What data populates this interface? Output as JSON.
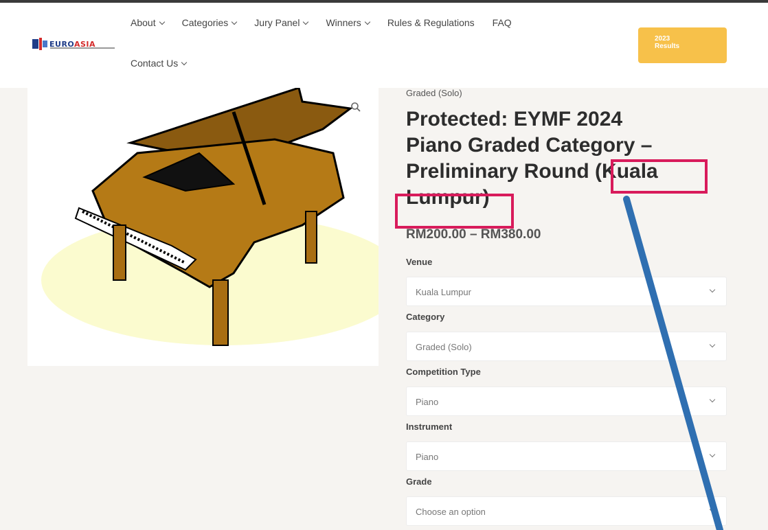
{
  "header": {
    "logo": {
      "part1": "EURO",
      "part2": "ASIA"
    },
    "nav": [
      {
        "label": "About",
        "has_dropdown": true
      },
      {
        "label": "Categories",
        "has_dropdown": true
      },
      {
        "label": "Jury Panel",
        "has_dropdown": true
      },
      {
        "label": "Winners",
        "has_dropdown": true
      },
      {
        "label": "Rules & Regulations",
        "has_dropdown": false
      },
      {
        "label": "FAQ",
        "has_dropdown": false
      },
      {
        "label": "Contact Us",
        "has_dropdown": true
      }
    ],
    "results_button": {
      "line1": "2023",
      "line2": "Results"
    }
  },
  "product": {
    "category": "Graded (Solo)",
    "title": "Protected: EYMF 2024 Piano Graded Category – Preliminary Round (Kuala Lumpur)",
    "title_lines": [
      "Protected: EYMF 2024",
      "Piano Graded Category –",
      "Preliminary Round (Kuala",
      "Lumpur)"
    ],
    "price": "RM200.00 – RM380.00",
    "fields": [
      {
        "label": "Venue",
        "value": "Kuala Lumpur"
      },
      {
        "label": "Category",
        "value": "Graded (Solo)"
      },
      {
        "label": "Competition Type",
        "value": "Piano"
      },
      {
        "label": "Instrument",
        "value": "Piano"
      },
      {
        "label": "Grade",
        "value": "Choose an option"
      }
    ]
  },
  "image": {
    "alt": "piano-illustration",
    "icon": "search-icon"
  },
  "annotation": {
    "highlight_color": "#d81b5b",
    "arrow_color": "#2f6fb1"
  },
  "colors": {
    "accent": "#f7c14a",
    "background": "#f6f4f1"
  }
}
